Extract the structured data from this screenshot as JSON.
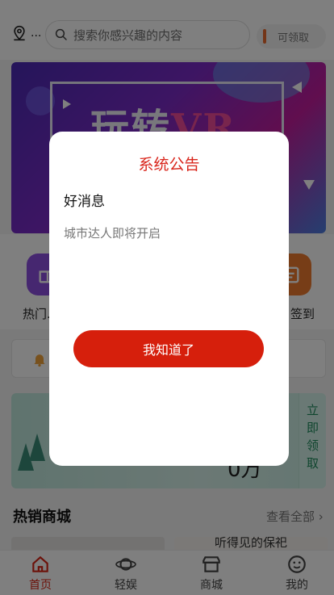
{
  "header": {
    "location_text": "...",
    "search_placeholder": "搜索你感兴趣的内容",
    "claim_label": "可领取"
  },
  "banner": {
    "title_main": "玩转",
    "title_accent": "VR"
  },
  "quick_icons": [
    {
      "label": "热门...",
      "icon": "gift-icon"
    },
    {
      "label": "签到",
      "icon": "calendar-icon"
    }
  ],
  "promo": {
    "amount_text": "0万",
    "side_chars": [
      "立",
      "即",
      "领",
      "取"
    ]
  },
  "hot_section": {
    "title": "热销商城",
    "more_label": "查看全部",
    "peek_text": "听得见的保祀"
  },
  "bottom_nav": [
    {
      "label": "首页",
      "icon": "home-icon",
      "active": true
    },
    {
      "label": "轻娱",
      "icon": "planet-icon",
      "active": false
    },
    {
      "label": "商城",
      "icon": "store-icon",
      "active": false
    },
    {
      "label": "我的",
      "icon": "smiley-icon",
      "active": false
    }
  ],
  "modal": {
    "title": "系统公告",
    "heading": "好消息",
    "body": "城市达人即将开启",
    "button_label": "我知道了"
  },
  "colors": {
    "accent_red": "#d61f0c",
    "title_red": "#d9261c",
    "overlay": "rgba(0,0,0,0.5)"
  }
}
